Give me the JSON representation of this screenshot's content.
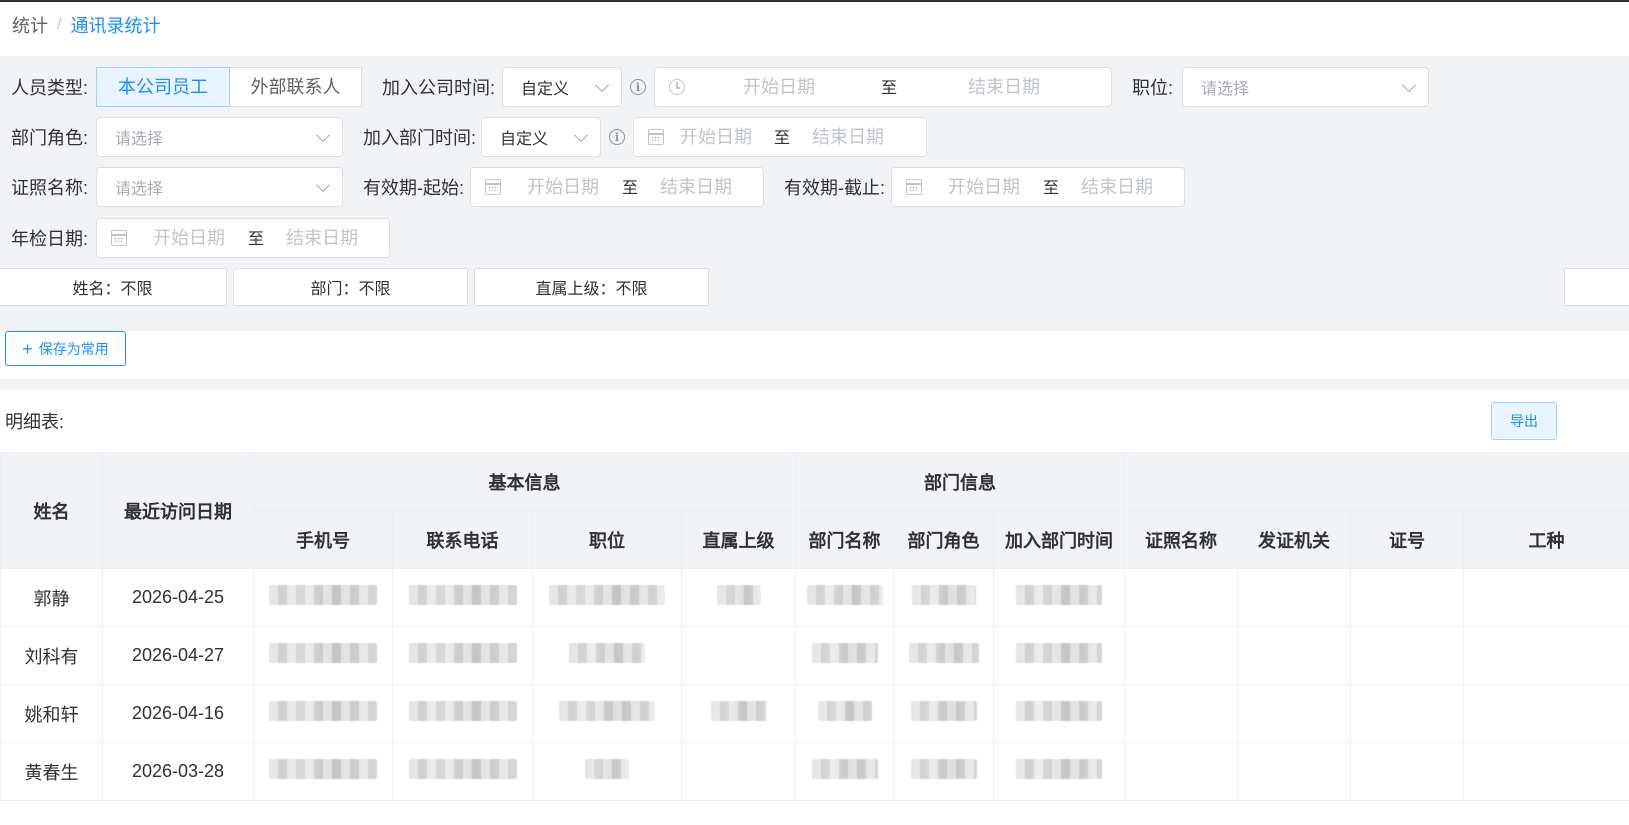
{
  "breadcrumb": {
    "root": "统计",
    "separator": "/",
    "current": "通讯录统计"
  },
  "filters": {
    "person_type": {
      "label": "人员类型:",
      "options": [
        "本公司员工",
        "外部联系人"
      ],
      "selected": "本公司员工"
    },
    "join_company_time": {
      "label": "加入公司时间:",
      "mode": "自定义",
      "start_placeholder": "开始日期",
      "to": "至",
      "end_placeholder": "结束日期"
    },
    "position": {
      "label": "职位:",
      "placeholder": "请选择"
    },
    "dept_role": {
      "label": "部门角色:",
      "placeholder": "请选择"
    },
    "join_dept_time": {
      "label": "加入部门时间:",
      "mode": "自定义",
      "start_placeholder": "开始日期",
      "to": "至",
      "end_placeholder": "结束日期"
    },
    "license_name": {
      "label": "证照名称:",
      "placeholder": "请选择"
    },
    "valid_start": {
      "label": "有效期-起始:",
      "start_placeholder": "开始日期",
      "to": "至",
      "end_placeholder": "结束日期"
    },
    "valid_end": {
      "label": "有效期-截止:",
      "start_placeholder": "开始日期",
      "to": "至",
      "end_placeholder": "结束日期"
    },
    "annual_check": {
      "label": "年检日期:",
      "start_placeholder": "开始日期",
      "to": "至",
      "end_placeholder": "结束日期"
    },
    "chips": [
      "姓名：不限",
      "部门：不限",
      "直属上级：不限"
    ]
  },
  "actions": {
    "save_common": "保存为常用",
    "export": "导出"
  },
  "detail": {
    "title": "明细表:"
  },
  "table": {
    "group_headers": {
      "basic": "基本信息",
      "dept": "部门信息"
    },
    "columns": {
      "name": "姓名",
      "last_visit": "最近访问日期",
      "mobile": "手机号",
      "phone": "联系电话",
      "position": "职位",
      "supervisor": "直属上级",
      "dept_name": "部门名称",
      "dept_role": "部门角色",
      "join_dept_time": "加入部门时间",
      "license_name": "证照名称",
      "issuer": "发证机关",
      "cert_no": "证号",
      "work_type": "工种"
    },
    "rows": [
      {
        "name": "郭静",
        "last_visit": "2026-04-25"
      },
      {
        "name": "刘科有",
        "last_visit": "2026-04-27"
      },
      {
        "name": "姚和轩",
        "last_visit": "2026-04-16"
      },
      {
        "name": "黄春生",
        "last_visit": "2026-03-28"
      }
    ]
  },
  "colors": {
    "accent": "#1890ff",
    "panel_bg": "#f2f3f5",
    "border": "#dcdfe6"
  }
}
